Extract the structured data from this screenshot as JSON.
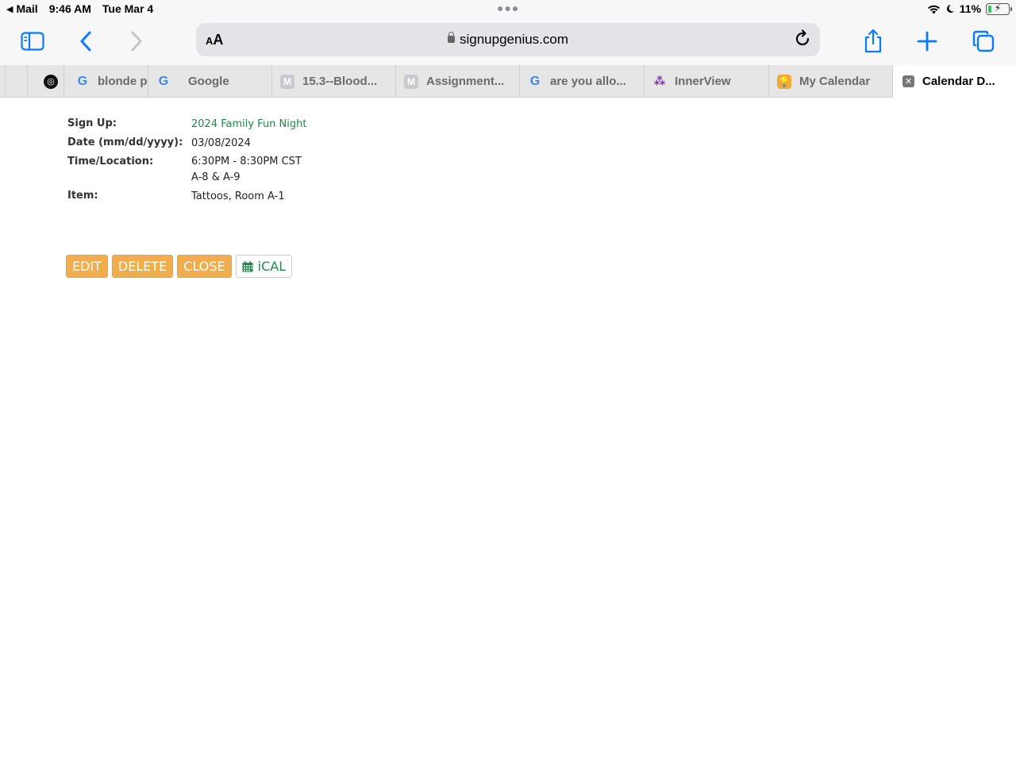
{
  "status_bar": {
    "back_app": "Mail",
    "time": "9:46 AM",
    "date": "Tue Mar 4",
    "battery": "11%"
  },
  "browser": {
    "text_size_label": "AA",
    "url": "signupgenius.com",
    "accent": "#0a7aff"
  },
  "tabs": [
    {
      "label": "",
      "favicon": "openai-icon"
    },
    {
      "label": "blonde p",
      "favicon": "google-icon"
    },
    {
      "label": "Google",
      "favicon": "google-icon"
    },
    {
      "label": "15.3--Blood...",
      "favicon": "m-icon"
    },
    {
      "label": "Assignment...",
      "favicon": "m-icon"
    },
    {
      "label": "are you allo...",
      "favicon": "google-icon"
    },
    {
      "label": "InnerView",
      "favicon": "innerview-icon"
    },
    {
      "label": "My Calendar",
      "favicon": "calendar-icon"
    },
    {
      "label": "Calendar D...",
      "favicon": "close-icon",
      "active": true
    }
  ],
  "details": {
    "signup_label": "Sign Up:",
    "signup_value": "2024 Family Fun Night",
    "date_label": "Date (mm/dd/yyyy):",
    "date_value": "03/08/2024",
    "time_label": "Time/Location:",
    "time_value": "6:30PM - 8:30PM CST",
    "location_value": "A-8 & A-9",
    "item_label": "Item:",
    "item_value": "Tattoos, Room A-1"
  },
  "actions": {
    "edit": "EDIT",
    "delete": "DELETE",
    "close": "CLOSE",
    "ical": "iCAL",
    "button_color": "#f0ad4e",
    "link_color": "#1e8a4a"
  }
}
